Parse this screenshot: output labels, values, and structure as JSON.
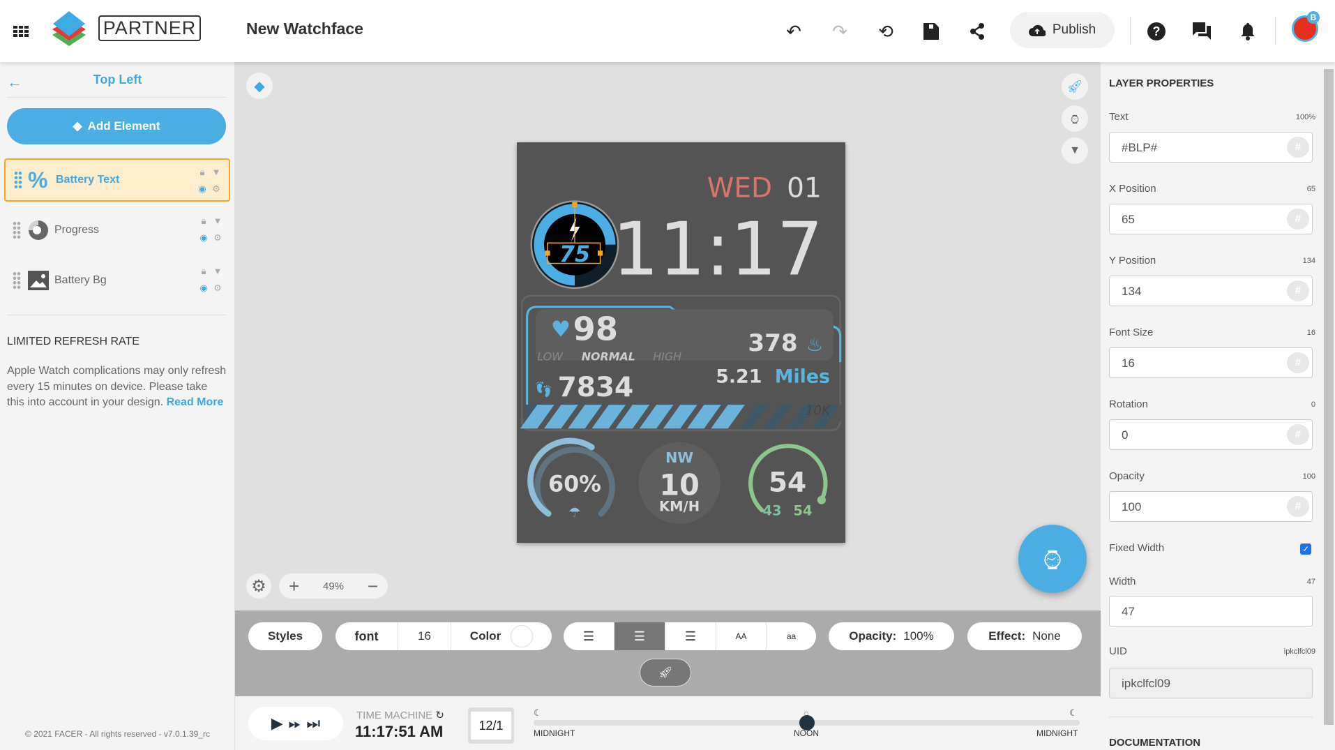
{
  "header": {
    "brand": "PARTNER",
    "title": "New Watchface",
    "publish": "Publish",
    "avatar_badge": "B",
    "icons": [
      "apps-grid-icon",
      "undo-icon",
      "redo-icon",
      "history-icon",
      "save-icon",
      "share-icon",
      "cloud-upload-icon",
      "help-icon",
      "chat-icon",
      "bell-icon"
    ]
  },
  "left": {
    "title": "Top Left",
    "add_element": "Add Element",
    "layers": [
      {
        "name": "Battery Text",
        "icon": "percent-icon",
        "selected": true
      },
      {
        "name": "Progress",
        "icon": "progress-icon"
      },
      {
        "name": "Battery Bg",
        "icon": "image-icon"
      }
    ],
    "notice_title": "LIMITED REFRESH RATE",
    "notice_text": "Apple Watch complications may only refresh every 15 minutes on device. Please take this into account in your design.",
    "read_more": "Read More",
    "footer": "© 2021 FACER - All rights reserved - v7.0.1.39_rc"
  },
  "watch": {
    "day": "WED",
    "date": "01",
    "time": "11:17",
    "battery": "75",
    "heart": "98",
    "hr_low": "LOW",
    "hr_normal": "NORMAL",
    "hr_high": "HIGH",
    "calories": "378",
    "steps": "7834",
    "distance": "5.21",
    "distance_unit": "Miles",
    "goal": "10K",
    "rain": "60%",
    "wind_dir": "NW",
    "wind_speed": "10",
    "wind_unit": "KM/H",
    "temp": "54",
    "temp_low": "43",
    "temp_high": "54",
    "colors": {
      "bg": "#545454",
      "accent": "#5ab4e0",
      "day": "#d9756b",
      "green": "#8cc68c"
    }
  },
  "canvas": {
    "zoom": "49%"
  },
  "toolbar": {
    "styles": "Styles",
    "font": "font",
    "font_size": "16",
    "color": "Color",
    "uppercase": "AA",
    "lowercase": "aa",
    "opacity_label": "Opacity:",
    "opacity": "100%",
    "effect_label": "Effect:",
    "effect": "None",
    "align_selected": "center"
  },
  "timeline": {
    "title": "TIME MACHINE",
    "time": "11:17:51 AM",
    "date": "12/1",
    "labels": [
      "MIDNIGHT",
      "NOON",
      "MIDNIGHT"
    ],
    "position": 0.5
  },
  "props": {
    "title": "LAYER PROPERTIES",
    "fields": [
      {
        "label": "Text",
        "value": "#BLP#",
        "hint": "100%"
      },
      {
        "label": "X Position",
        "value": "65",
        "hint": "65"
      },
      {
        "label": "Y Position",
        "value": "134",
        "hint": "134"
      },
      {
        "label": "Font Size",
        "value": "16",
        "hint": "16"
      },
      {
        "label": "Rotation",
        "value": "0",
        "hint": "0"
      },
      {
        "label": "Opacity",
        "value": "100",
        "hint": "100"
      }
    ],
    "fixed_width": "Fixed Width",
    "fixed_width_checked": true,
    "width_label": "Width",
    "width_value": "47",
    "width_hint": "47",
    "uid_label": "UID",
    "uid_value": "ipkclfcl09",
    "uid_hint": "ipkclfcl09",
    "documentation": "DOCUMENTATION"
  }
}
